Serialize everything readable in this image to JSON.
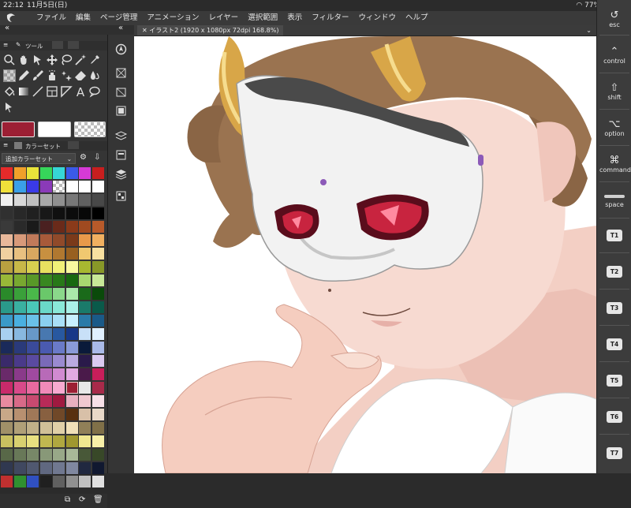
{
  "status": {
    "time": "22:12",
    "date": "11月5日(日)",
    "battery": "77%"
  },
  "menu": [
    "ファイル",
    "編集",
    "ページ管理",
    "アニメーション",
    "レイヤー",
    "選択範囲",
    "表示",
    "フィルター",
    "ウィンドウ",
    "ヘルプ"
  ],
  "tool_panel": {
    "tab_label": "ツール"
  },
  "color_panel": {
    "tab_label": "カラーセット",
    "set_name": "追加カラーセット"
  },
  "document": {
    "tab_title": "イラスト2 (1920 x 1080px 72dpi 168.8%)"
  },
  "colors": {
    "main": "#9c1f34",
    "sub": "#ffffff"
  },
  "right_keys": [
    {
      "label": "esc",
      "icon": "undo-arrow-icon"
    },
    {
      "label": "control",
      "icon": "caret-up-icon"
    },
    {
      "label": "shift",
      "icon": "shift-arrow-icon"
    },
    {
      "label": "option",
      "icon": "option-key-icon"
    },
    {
      "label": "command",
      "icon": "command-key-icon"
    },
    {
      "label": "space",
      "icon": "space-bar-icon"
    }
  ],
  "t_keys": [
    "T1",
    "T2",
    "T3",
    "T4",
    "T5",
    "T6",
    "T7"
  ]
}
